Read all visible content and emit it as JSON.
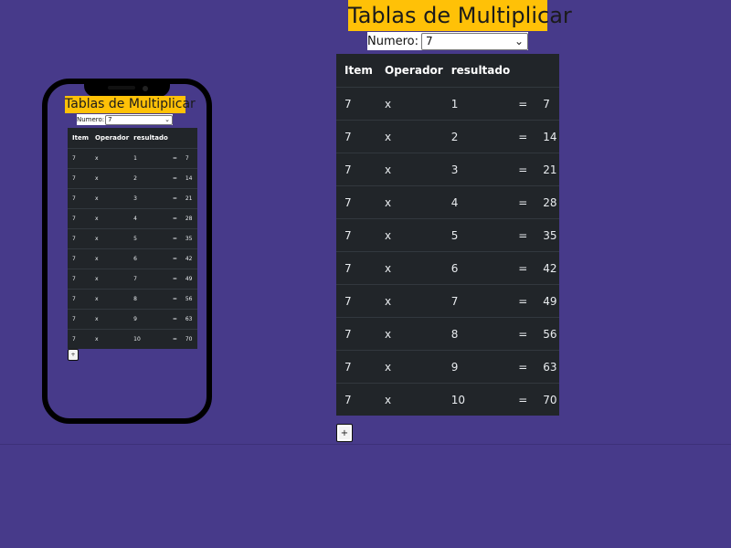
{
  "title": "Tablas de Multiplicar",
  "selector": {
    "label": "Numero:",
    "value": "7"
  },
  "table": {
    "headers": [
      "Item",
      "Operador",
      "resultado"
    ],
    "rows": [
      {
        "item": "7",
        "op": "x",
        "n": "1",
        "eq": "=",
        "result": "7"
      },
      {
        "item": "7",
        "op": "x",
        "n": "2",
        "eq": "=",
        "result": "14"
      },
      {
        "item": "7",
        "op": "x",
        "n": "3",
        "eq": "=",
        "result": "21"
      },
      {
        "item": "7",
        "op": "x",
        "n": "4",
        "eq": "=",
        "result": "28"
      },
      {
        "item": "7",
        "op": "x",
        "n": "5",
        "eq": "=",
        "result": "35"
      },
      {
        "item": "7",
        "op": "x",
        "n": "6",
        "eq": "=",
        "result": "42"
      },
      {
        "item": "7",
        "op": "x",
        "n": "7",
        "eq": "=",
        "result": "49"
      },
      {
        "item": "7",
        "op": "x",
        "n": "8",
        "eq": "=",
        "result": "56"
      },
      {
        "item": "7",
        "op": "x",
        "n": "9",
        "eq": "=",
        "result": "63"
      },
      {
        "item": "7",
        "op": "x",
        "n": "10",
        "eq": "=",
        "result": "70"
      }
    ]
  },
  "add_button": {
    "icon": "plus-icon",
    "label": "+"
  },
  "colors": {
    "background": "#473a8a",
    "title_bg": "#ffc107",
    "table_bg": "#212529"
  }
}
